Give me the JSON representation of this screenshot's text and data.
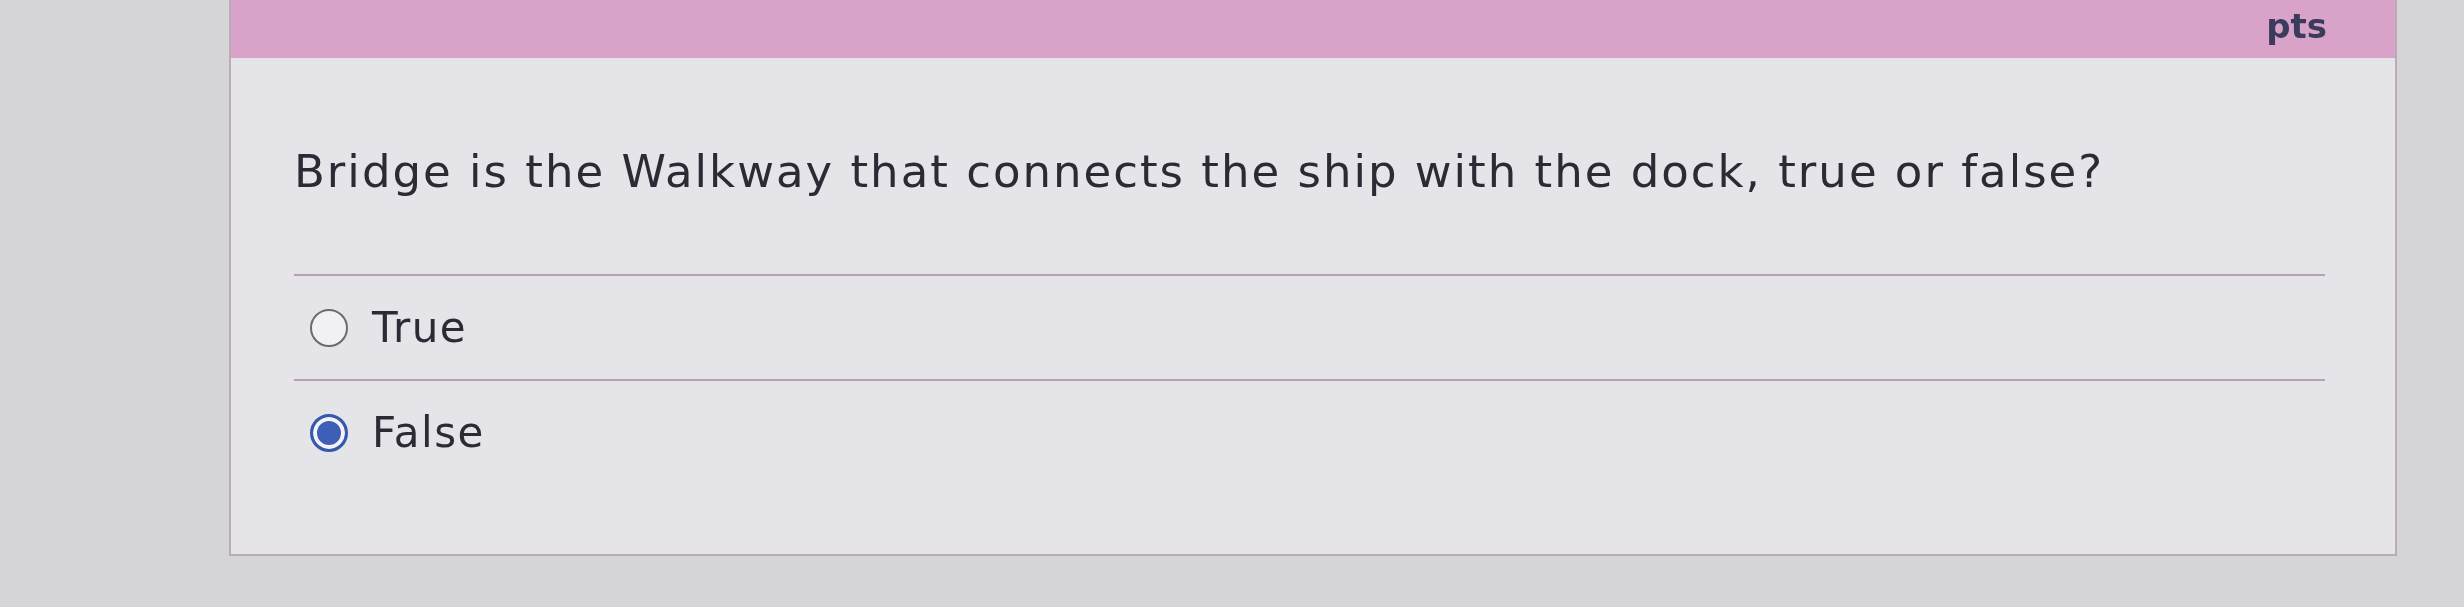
{
  "header": {
    "points": "pts"
  },
  "question": {
    "text": "Bridge is the Walkway that connects the ship with the dock, true or false?"
  },
  "options": [
    {
      "label": "True",
      "selected": false
    },
    {
      "label": "False",
      "selected": true
    }
  ]
}
